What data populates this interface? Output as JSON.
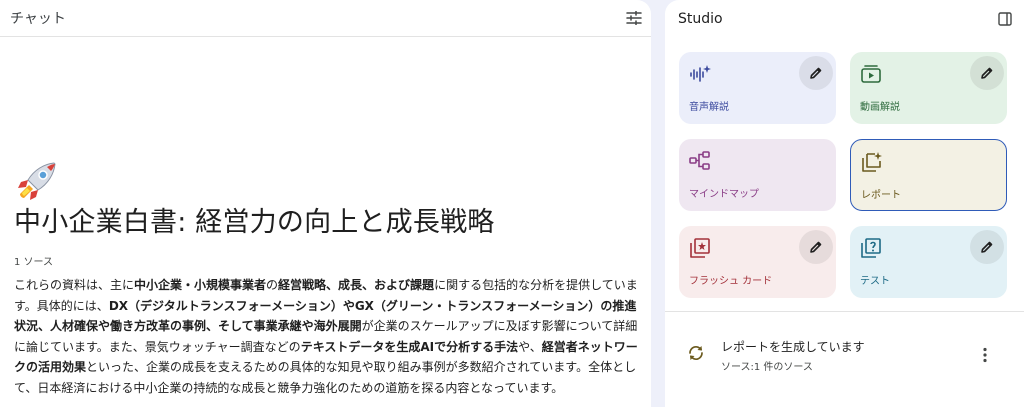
{
  "chat": {
    "title": "チャット",
    "tune_icon": "tune-icon",
    "emoji": "rocket-emoji",
    "notebook_title": "中小企業白書: 経営力の向上と成長戦略",
    "source_count": "1 ソース",
    "summary_parts": [
      {
        "t": "これらの資料は、主に",
        "b": false
      },
      {
        "t": "中小企業・小規模事業者",
        "b": true
      },
      {
        "t": "の",
        "b": false
      },
      {
        "t": "経営戦略、成長、および課題",
        "b": true
      },
      {
        "t": "に関する包括的な分析を提供しています。具体的には、",
        "b": false
      },
      {
        "t": "DX（デジタルトランスフォーメーション）やGX（グリーン・トランスフォーメーション）の推進状況、人材確保や働き方改革の事例、そして事業承継や海外展開",
        "b": true
      },
      {
        "t": "が企業のスケールアップに及ぼす影響について詳細に論じています。また、景気ウォッチャー調査などの",
        "b": false
      },
      {
        "t": "テキストデータを生成AIで分析する手法",
        "b": true
      },
      {
        "t": "や、",
        "b": false
      },
      {
        "t": "経営者ネットワークの活用効果",
        "b": true
      },
      {
        "t": "といった、企業の成長を支えるための具体的な知見や取り組み事例が多数紹介されています。全体として、日本経済における中小企業の持続的な成長と競争力強化のための道筋を探る内容となっています。",
        "b": false
      }
    ]
  },
  "studio": {
    "title": "Studio",
    "panel_icon": "side-panel-icon",
    "cards": [
      {
        "label": "音声解説",
        "icon": "audio-waveform-icon",
        "bg": "#ebeefa",
        "color": "#3c4a9e",
        "edit": true
      },
      {
        "label": "動画解説",
        "icon": "video-icon",
        "bg": "#e3f2e6",
        "color": "#2e6b3d",
        "edit": true
      },
      {
        "label": "マインドマップ",
        "icon": "mind-map-icon",
        "bg": "#efe7f1",
        "color": "#8a3d86",
        "edit": false
      },
      {
        "label": "レポート",
        "icon": "report-icon",
        "bg": "#f3f1e4",
        "color": "#6b5a1e",
        "edit": false
      },
      {
        "label": "フラッシュ カード",
        "icon": "flashcard-icon",
        "bg": "#f8ecec",
        "color": "#a3313a",
        "edit": true
      },
      {
        "label": "テスト",
        "icon": "quiz-icon",
        "bg": "#e2f1f6",
        "color": "#1d6a85",
        "edit": true
      }
    ],
    "report_status": {
      "title": "レポートを生成しています",
      "sub": "ソース:1 件のソース",
      "icon": "sync-icon",
      "menu_icon": "more-vert-icon"
    }
  }
}
